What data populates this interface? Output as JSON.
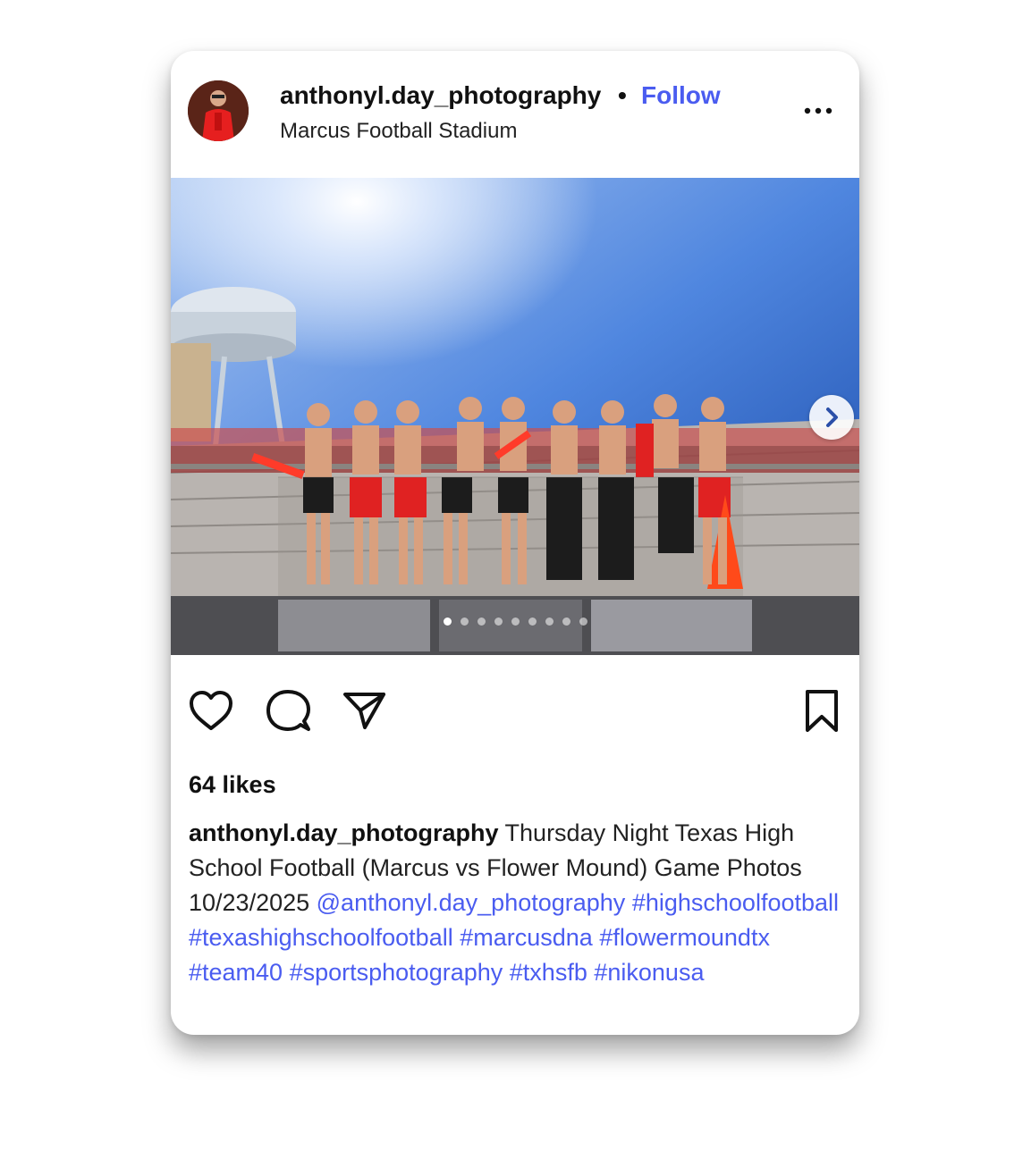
{
  "post": {
    "username": "anthonyl.day_photography",
    "separator": "•",
    "follow_label": "Follow",
    "location": "Marcus Football Stadium",
    "more_icon": "more-horizontal-icon"
  },
  "photo": {
    "total_slides": 9,
    "active_slide": 1
  },
  "actions": {
    "like_icon": "heart-icon",
    "comment_icon": "comment-icon",
    "share_icon": "send-icon",
    "save_icon": "bookmark-icon"
  },
  "likes_text": "64 likes",
  "caption": {
    "username": "anthonyl.day_photography",
    "text": " Thursday Night Texas High School Football (Marcus vs Flower Mound) Game Photos 10/23/2025 ",
    "mention": "@anthonyl.day_photography",
    "hashtags": [
      "#highschoolfootball",
      "#texashighschoolfootball",
      "#marcusdna",
      "#flowermoundtx",
      "#team40",
      "#sportsphotography",
      "#txhsfb",
      "#nikonusa"
    ]
  },
  "colors": {
    "link": "#4a5cf0",
    "text": "#111111"
  }
}
